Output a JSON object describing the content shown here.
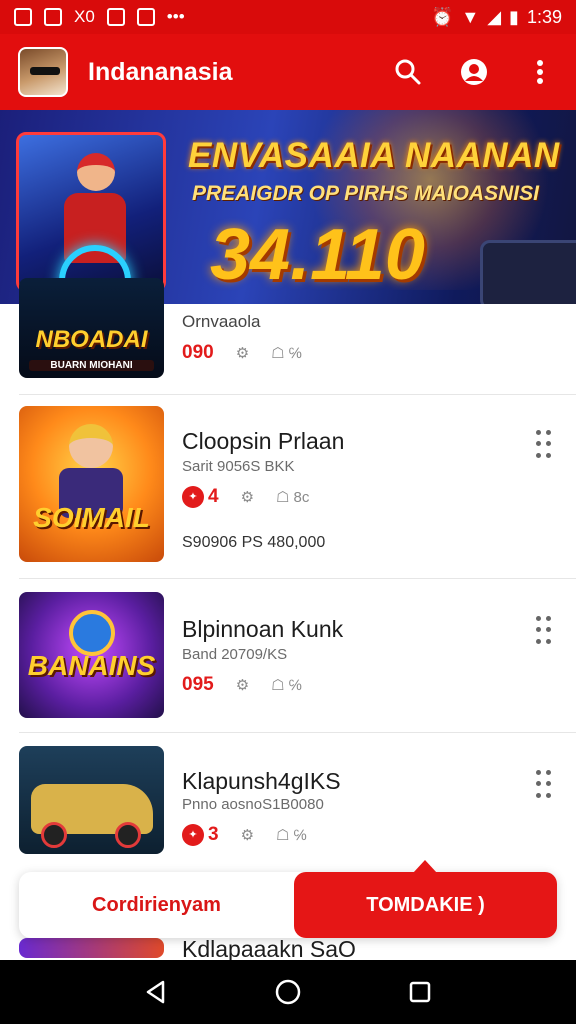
{
  "status_bar": {
    "time": "1:39",
    "left_text": "X0"
  },
  "app_bar": {
    "title": "Indananasia",
    "icons": [
      "avatar",
      "search-icon",
      "profile-icon",
      "more-vert-icon"
    ]
  },
  "banner": {
    "line1": "ENVASAAIA NAANAN",
    "line2": "PREAIGDR OP PIRHS MAIOASNISI",
    "amount": "34.110"
  },
  "items": [
    {
      "thumb_label": "NBOADAI",
      "thumb_sub": "BUARN MIOHANI",
      "title": "",
      "subtitle": "Ornvaaola",
      "price": "090",
      "stat1": "",
      "stat2": "℅",
      "meta": ""
    },
    {
      "thumb_label": "SOIMAIL",
      "thumb_sub": "",
      "title": "Cloopsin Prlaan",
      "subtitle": "Sarit 9056S BKK",
      "price": "",
      "badge": "4",
      "stat1": "",
      "stat2": "8c",
      "meta": "S90906  PS 480,000"
    },
    {
      "thumb_label": "BANAINS",
      "thumb_sub": "",
      "title": "Blpinnoan Kunk",
      "subtitle": "Band 20709/KS",
      "price": "095",
      "stat1": "",
      "stat2": "℅",
      "meta": ""
    },
    {
      "thumb_label": "",
      "thumb_sub": "",
      "title": "Klapunsh4gIKS",
      "subtitle": "Pnno aosnoS1B0080",
      "price": "",
      "badge": "3",
      "stat1": "",
      "stat2": "℅",
      "meta": ""
    },
    {
      "title": "Kdlapaaakn SaO"
    }
  ],
  "action_bar": {
    "left_label": "Cordirienyam",
    "right_label": "TOMDAKIE )"
  },
  "nav_bar": {
    "icons": [
      "back-icon",
      "home-icon",
      "recents-icon"
    ]
  },
  "colors": {
    "brand_red": "#e20e0e",
    "price_red": "#e21b1b"
  }
}
